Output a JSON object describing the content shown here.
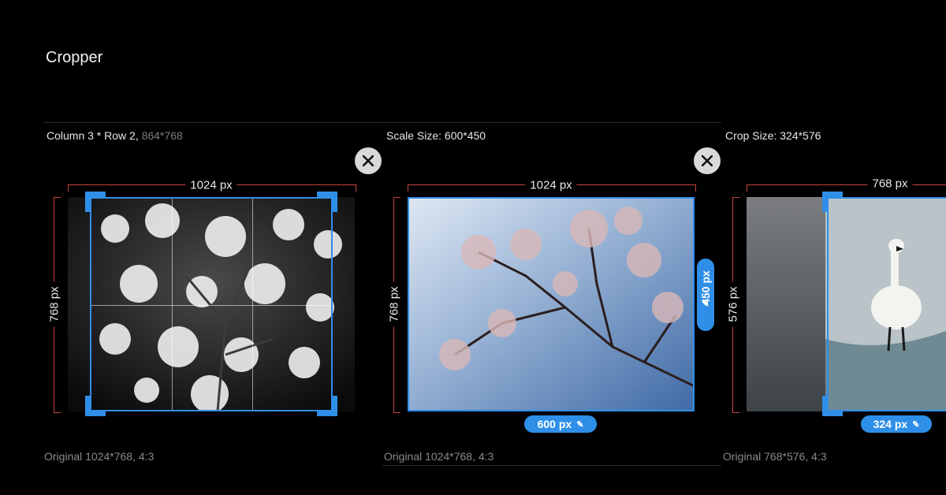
{
  "app": {
    "title": "Cropper"
  },
  "panels": [
    {
      "header_main": "Column 3 * Row 2,",
      "header_dim": "864*768",
      "dim_top": "1024 px",
      "dim_left": "768 px",
      "footer": "Original 1024*768, 4:3",
      "image": "night cherry blossoms with crop grid"
    },
    {
      "header_main": "Scale Size: 600*450",
      "dim_top": "1024 px",
      "dim_left": "768 px",
      "width_pill": "600 px",
      "height_pill": "450 px",
      "footer": "Original 1024*768, 4:3",
      "image": "cherry blossoms against blue sky"
    },
    {
      "header_main": "Crop Size: 324*576",
      "dim_top": "768 px",
      "dim_left": "576 px",
      "width_pill": "324 px",
      "footer": "Original 768*576, 4:3",
      "image": "white swan standing on ice"
    }
  ],
  "icons": {
    "close": "close-icon",
    "edit": "pencil-icon"
  },
  "colors": {
    "accent": "#2f8fe8",
    "dimension_line": "#c6443f",
    "background": "#000000"
  }
}
